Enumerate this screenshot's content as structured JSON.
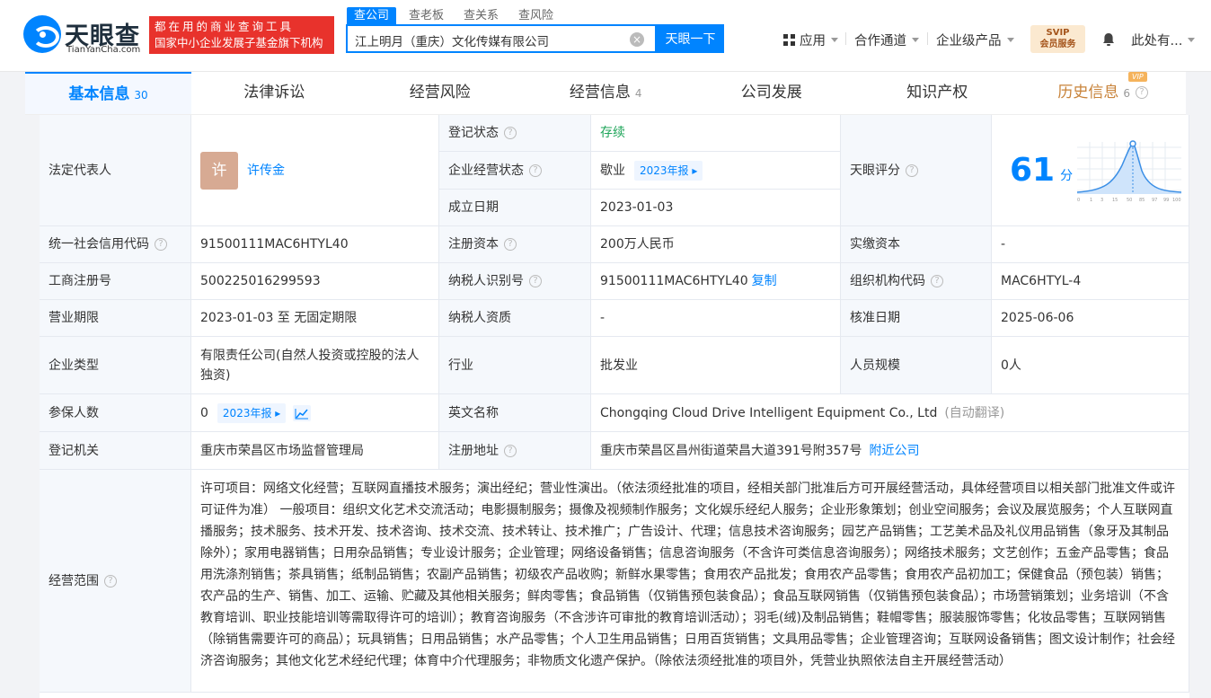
{
  "header": {
    "logo_cn": "天眼查",
    "logo_en": "TianYanCha.com",
    "banner_line1": "都在用的商业查询工具",
    "banner_line2": "国家中小企业发展子基金旗下机构",
    "search_tabs": [
      "查公司",
      "查老板",
      "查关系",
      "查风险"
    ],
    "search_value": "江上明月（重庆）文化传媒有限公司",
    "search_button": "天眼一下",
    "nav_apps": "应用",
    "nav_channel": "合作通道",
    "nav_enterprise": "企业级产品",
    "svip_line1": "SVIP",
    "svip_line2": "会员服务",
    "user": "此处有..."
  },
  "tabs": [
    {
      "label": "基本信息",
      "count": "30"
    },
    {
      "label": "法律诉讼",
      "count": ""
    },
    {
      "label": "经营风险",
      "count": ""
    },
    {
      "label": "经营信息",
      "count": "4"
    },
    {
      "label": "公司发展",
      "count": ""
    },
    {
      "label": "知识产权",
      "count": ""
    },
    {
      "label": "历史信息",
      "count": "6"
    }
  ],
  "vip_tag": "VIP",
  "info": {
    "legal_rep_label": "法定代表人",
    "legal_rep_avatar": "许",
    "legal_rep_name": "许传金",
    "reg_status_label": "登记状态",
    "reg_status": "存续",
    "biz_status_label": "企业经营状态",
    "biz_status": "歇业",
    "report_year": "2023年报",
    "founded_label": "成立日期",
    "founded": "2023-01-03",
    "score_label": "天眼评分",
    "score": "61",
    "score_unit": "分",
    "score_axis": [
      "0",
      "1",
      "3",
      "15",
      "50",
      "85",
      "97",
      "99",
      "100"
    ],
    "credit_code_label": "统一社会信用代码",
    "credit_code": "91500111MAC6HTYL40",
    "reg_capital_label": "注册资本",
    "reg_capital": "200万人民币",
    "paid_capital_label": "实缴资本",
    "paid_capital": "-",
    "biz_reg_no_label": "工商注册号",
    "biz_reg_no": "500225016299593",
    "taxpayer_id_label": "纳税人识别号",
    "taxpayer_id": "91500111MAC6HTYL40",
    "copy": "复制",
    "org_code_label": "组织机构代码",
    "org_code": "MAC6HTYL-4",
    "term_label": "营业期限",
    "term": "2023-01-03 至 无固定期限",
    "taxpayer_qual_label": "纳税人资质",
    "taxpayer_qual": "-",
    "approval_date_label": "核准日期",
    "approval_date": "2025-06-06",
    "company_type_label": "企业类型",
    "company_type": "有限责任公司(自然人投资或控股的法人独资)",
    "industry_label": "行业",
    "industry": "批发业",
    "staff_size_label": "人员规模",
    "staff_size": "0人",
    "insured_label": "参保人数",
    "insured": "0",
    "en_name_label": "英文名称",
    "en_name": "Chongqing Cloud Drive Intelligent Equipment Co., Ltd",
    "auto_translate": "(自动翻译)",
    "reg_authority_label": "登记机关",
    "reg_authority": "重庆市荣昌区市场监督管理局",
    "reg_address_label": "注册地址",
    "reg_address": "重庆市荣昌区昌州街道荣昌大道391号附357号",
    "nearby": "附近公司",
    "scope_label": "经营范围",
    "scope": "许可项目：网络文化经营；互联网直播技术服务；演出经纪；营业性演出。（依法须经批准的项目，经相关部门批准后方可开展经营活动，具体经营项目以相关部门批准文件或许可证件为准） 一般项目：组织文化艺术交流活动；电影摄制服务；摄像及视频制作服务；文化娱乐经纪人服务；企业形象策划；创业空间服务；会议及展览服务；个人互联网直播服务；技术服务、技术开发、技术咨询、技术交流、技术转让、技术推广；广告设计、代理；信息技术咨询服务；园艺产品销售；工艺美术品及礼仪用品销售（象牙及其制品除外）；家用电器销售；日用杂品销售；专业设计服务；企业管理；网络设备销售；信息咨询服务（不含许可类信息咨询服务）；网络技术服务；文艺创作；五金产品零售；食品用洗涤剂销售；茶具销售；纸制品销售；农副产品销售；初级农产品收购；新鲜水果零售；食用农产品批发；食用农产品零售；食用农产品初加工；保健食品（预包装）销售；农产品的生产、销售、加工、运输、贮藏及其他相关服务；鲜肉零售；食品销售（仅销售预包装食品）；食品互联网销售（仅销售预包装食品）；市场营销策划；业务培训（不含教育培训、职业技能培训等需取得许可的培训）；教育咨询服务（不含涉许可审批的教育培训活动）；羽毛(绒)及制品销售；鞋帽零售；服装服饰零售；化妆品零售；互联网销售（除销售需要许可的商品）；玩具销售；日用品销售；水产品零售；个人卫生用品销售；日用百货销售；文具用品零售；企业管理咨询；互联网设备销售；图文设计制作；社会经济咨询服务；其他文化艺术经纪代理；体育中介代理服务；非物质文化遗产保护。（除依法须经批准的项目外，凭营业执照依法自主开展经营活动）"
  },
  "colors": {
    "accent": "#0084ff",
    "status_green": "#1fa55a",
    "banner_red": "#e8322c"
  }
}
